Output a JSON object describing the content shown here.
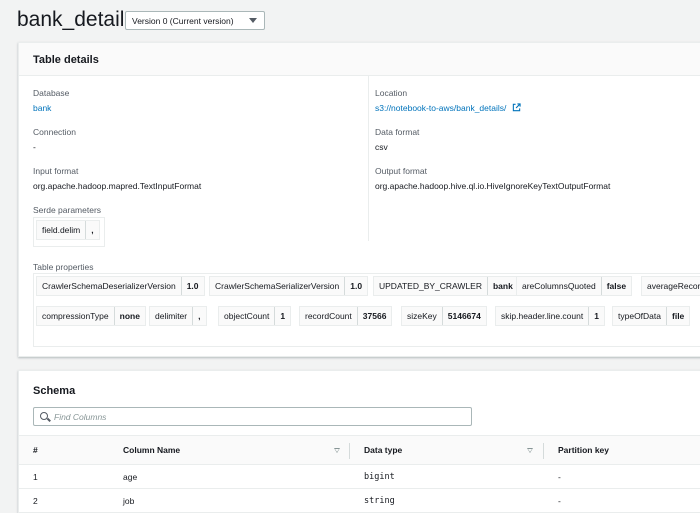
{
  "header": {
    "title": "bank_details",
    "version_select": "Version 0 (Current version)"
  },
  "table_details": {
    "heading": "Table details",
    "database_label": "Database",
    "database_value": "bank",
    "location_label": "Location",
    "location_value": "s3://notebook-to-aws/bank_details/",
    "connection_label": "Connection",
    "connection_value": "-",
    "data_format_label": "Data format",
    "data_format_value": "csv",
    "input_format_label": "Input format",
    "input_format_value": "org.apache.hadoop.mapred.TextInputFormat",
    "output_format_label": "Output format",
    "output_format_value": "org.apache.hadoop.hive.ql.io.HiveIgnoreKeyTextOutputFormat",
    "serde_label": "Serde parameters",
    "serde_params": [
      {
        "key": "field.delim",
        "value": ","
      }
    ],
    "table_props_label": "Table properties",
    "table_props_row1": [
      {
        "key": "CrawlerSchemaDeserializerVersion",
        "value": "1.0"
      },
      {
        "key": "CrawlerSchemaSerializerVersion",
        "value": "1.0"
      },
      {
        "key": "UPDATED_BY_CRAWLER",
        "value": "bank"
      },
      {
        "key": "areColumnsQuoted",
        "value": "false"
      },
      {
        "key": "averageRecor",
        "value": ""
      }
    ],
    "table_props_row2": [
      {
        "key": "compressionType",
        "value": "none"
      },
      {
        "key": "delimiter",
        "value": ","
      },
      {
        "key": "objectCount",
        "value": "1"
      },
      {
        "key": "recordCount",
        "value": "37566"
      },
      {
        "key": "sizeKey",
        "value": "5146674"
      },
      {
        "key": "skip.header.line.count",
        "value": "1"
      },
      {
        "key": "typeOfData",
        "value": "file"
      }
    ]
  },
  "schema": {
    "heading": "Schema",
    "search_placeholder": "Find Columns",
    "columns": {
      "num": "#",
      "name": "Column Name",
      "type": "Data type",
      "partition": "Partition key"
    },
    "rows": [
      {
        "num": "1",
        "name": "age",
        "type": "bigint",
        "partition": "-"
      },
      {
        "num": "2",
        "name": "job",
        "type": "string",
        "partition": "-"
      }
    ]
  }
}
